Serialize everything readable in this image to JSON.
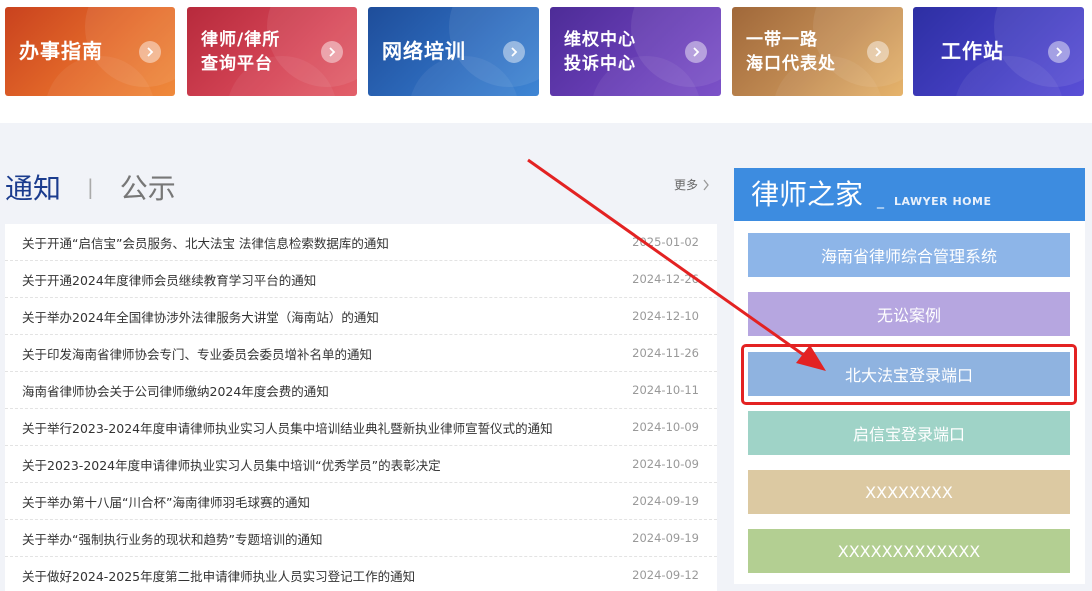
{
  "tiles": [
    {
      "label": "办事指南"
    },
    {
      "label": "律师/律所\n查询平台"
    },
    {
      "label": "网络培训"
    },
    {
      "label": "维权中心\n投诉中心"
    },
    {
      "label": "一带一路\n海口代表处"
    },
    {
      "label": "工作站"
    }
  ],
  "notices": {
    "tab_active": "通知",
    "separator": "|",
    "tab_other": "公示",
    "more_label": "更多",
    "items": [
      {
        "title": "关于开通“启信宝”会员服务、北大法宝 法律信息检索数据库的通知",
        "date": "2025-01-02"
      },
      {
        "title": "关于开通2024年度律师会员继续教育学习平台的通知",
        "date": "2024-12-26"
      },
      {
        "title": "关于举办2024年全国律协涉外法律服务大讲堂（海南站）的通知",
        "date": "2024-12-10"
      },
      {
        "title": "关于印发海南省律师协会专门、专业委员会委员增补名单的通知",
        "date": "2024-11-26"
      },
      {
        "title": "海南省律师协会关于公司律师缴纳2024年度会费的通知",
        "date": "2024-10-11"
      },
      {
        "title": "关于举行2023-2024年度申请律师执业实习人员集中培训结业典礼暨新执业律师宣誓仪式的通知",
        "date": "2024-10-09"
      },
      {
        "title": "关于2023-2024年度申请律师执业实习人员集中培训“优秀学员”的表彰决定",
        "date": "2024-10-09"
      },
      {
        "title": "关于举办第十八届“川合杯”海南律师羽毛球赛的通知",
        "date": "2024-09-19"
      },
      {
        "title": "关于举办“强制执行业务的现状和趋势”专题培训的通知",
        "date": "2024-09-19"
      },
      {
        "title": "关于做好2024-2025年度第二批申请律师执业人员实习登记工作的通知",
        "date": "2024-09-12"
      }
    ]
  },
  "lawyer_home": {
    "title": "律师之家",
    "dash": "_",
    "subtitle": "LAWYER HOME",
    "buttons": [
      {
        "label": "海南省律师综合管理系统"
      },
      {
        "label": "无讼案例"
      },
      {
        "label": "北大法宝登录端口"
      },
      {
        "label": "启信宝登录端口"
      },
      {
        "label": "XXXXXXXX"
      },
      {
        "label": "XXXXXXXXXXXXX"
      }
    ]
  },
  "annotation": {
    "color": "#e32222"
  }
}
